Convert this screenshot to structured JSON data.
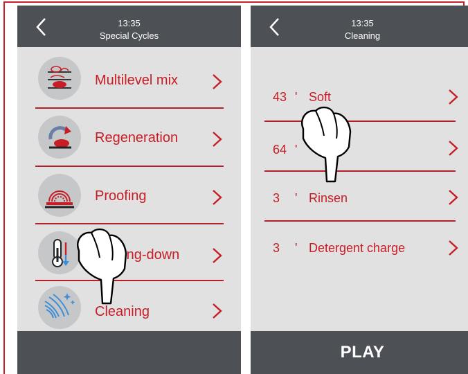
{
  "colors": {
    "accent": "#c81d25",
    "bar": "#4d5054",
    "panel": "#e1e1e1",
    "frame": "#c9202a"
  },
  "left_screen": {
    "time": "13:35",
    "title": "Special Cycles",
    "items": [
      {
        "label": "Multilevel mix",
        "icon": "multilevel-mix-icon"
      },
      {
        "label": "Regeneration",
        "icon": "regeneration-icon"
      },
      {
        "label": "Proofing",
        "icon": "proofing-icon"
      },
      {
        "label": "Cooling-down",
        "icon": "thermometer-icon"
      },
      {
        "label": "Cleaning",
        "icon": "cleaning-icon"
      }
    ]
  },
  "right_screen": {
    "time": "13:35",
    "title": "Cleaning",
    "items": [
      {
        "minutes": "43",
        "unit": "'",
        "label": "Soft"
      },
      {
        "minutes": "64",
        "unit": "'",
        "label": ""
      },
      {
        "minutes": "3",
        "unit": "'",
        "label": "Rinsen"
      },
      {
        "minutes": "3",
        "unit": "'",
        "label": "Detergent charge"
      }
    ],
    "play_label": "PLAY"
  }
}
